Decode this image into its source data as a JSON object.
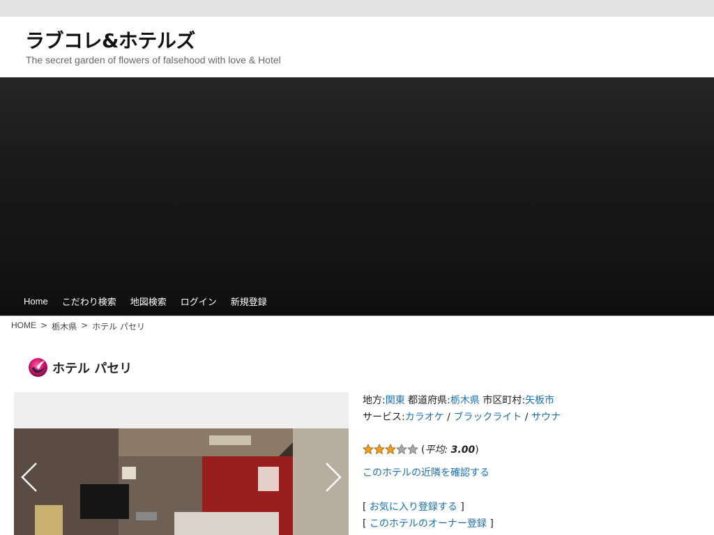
{
  "site": {
    "title": "ラブコレ&ホテルズ",
    "tagline": "The secret garden of flowers of falsehood with love & Hotel"
  },
  "nav": {
    "items": [
      "Home",
      "こだわり検索",
      "地図検索",
      "ログイン",
      "新規登録"
    ]
  },
  "breadcrumb": {
    "home": "HOME",
    "prefecture": "栃木県",
    "current": "ホテル パセリ",
    "separator": ">"
  },
  "hotel": {
    "name": "ホテル パセリ",
    "logo_icon": "swirl-logo-icon",
    "region_label": "地方",
    "region": "関東",
    "prefecture_label": "都道府県",
    "prefecture": "栃木県",
    "city_label": "市区町村",
    "city": "矢板市",
    "colon": ":",
    "services_label": "サービス",
    "services": [
      "カラオケ",
      "ブラックライト",
      "サウナ"
    ],
    "service_separator": "/",
    "rating": {
      "stars_filled": 3,
      "stars_total": 5,
      "avg_label": "平均",
      "avg_value": "3.00"
    },
    "nearby_link": "このホテルの近隣を確認する",
    "favorite_link": "お気に入り登録する",
    "owner_link": "このホテルのオーナー登録"
  },
  "gallery": {
    "prev_icon": "chevron-left-icon",
    "next_icon": "chevron-right-icon"
  },
  "colors": {
    "link": "#1a6fb5",
    "hero_dark": "#141414",
    "star_gold": "#f0a020"
  }
}
